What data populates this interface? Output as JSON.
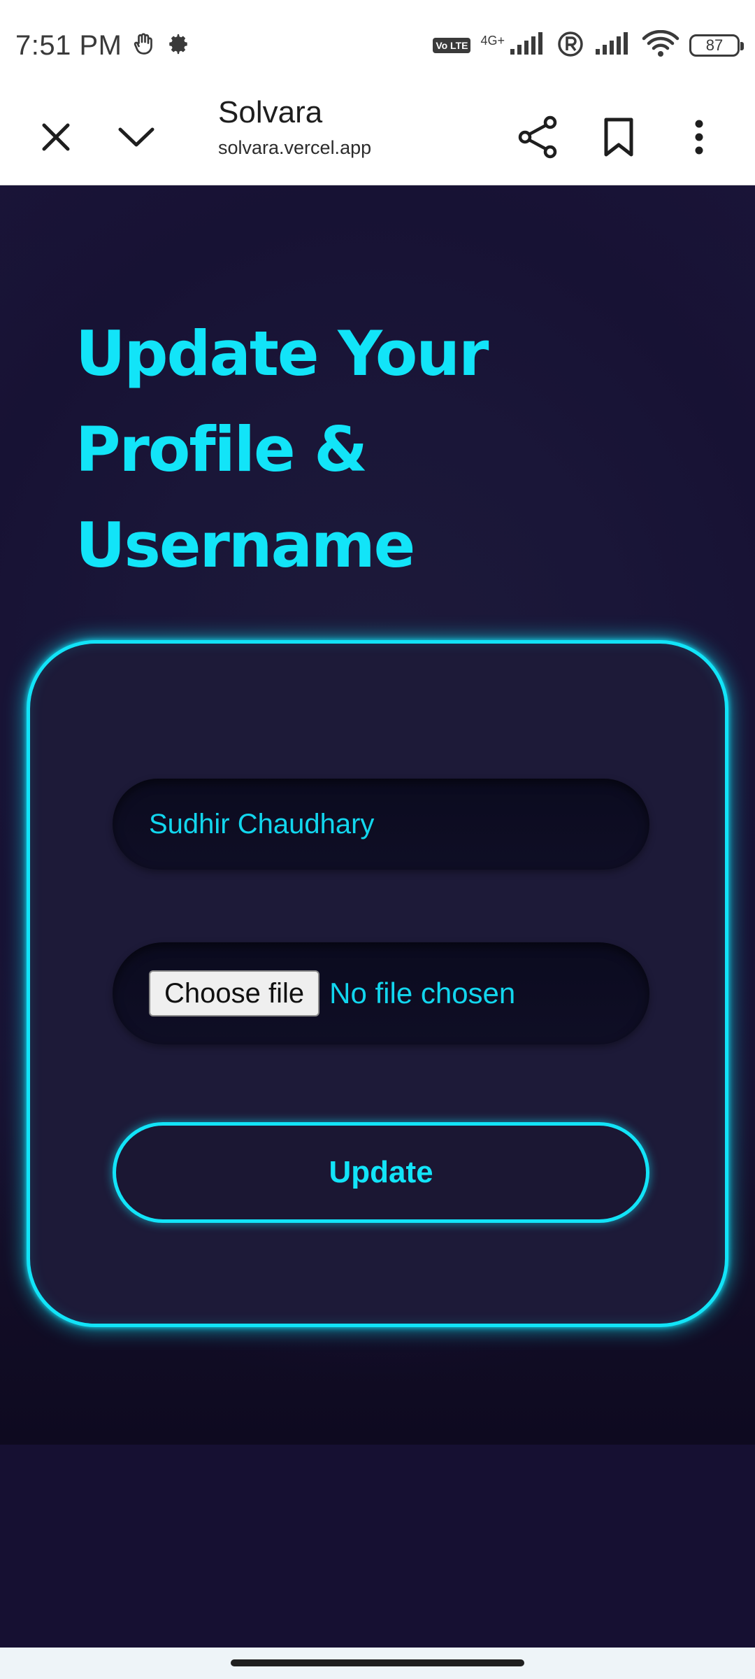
{
  "status_bar": {
    "time": "7:51 PM",
    "network_type": "4G+",
    "volte_label": "Vo LTE",
    "battery_level": "87"
  },
  "toolbar": {
    "title": "Solvara",
    "url": "solvara.vercel.app"
  },
  "page": {
    "heading": "Update Your Profile & Username",
    "form": {
      "name_value": "Sudhir Chaudhary",
      "file_button_label": "Choose file",
      "file_status": "No file chosen",
      "submit_label": "Update"
    }
  },
  "colors": {
    "accent": "#12e4f8",
    "background": "#161032",
    "card_background": "#1d1a38"
  },
  "icons": {
    "close": "close-icon",
    "collapse": "chevron-down-icon",
    "share": "share-icon",
    "bookmark": "bookmark-icon",
    "menu": "more-vertical-icon"
  }
}
